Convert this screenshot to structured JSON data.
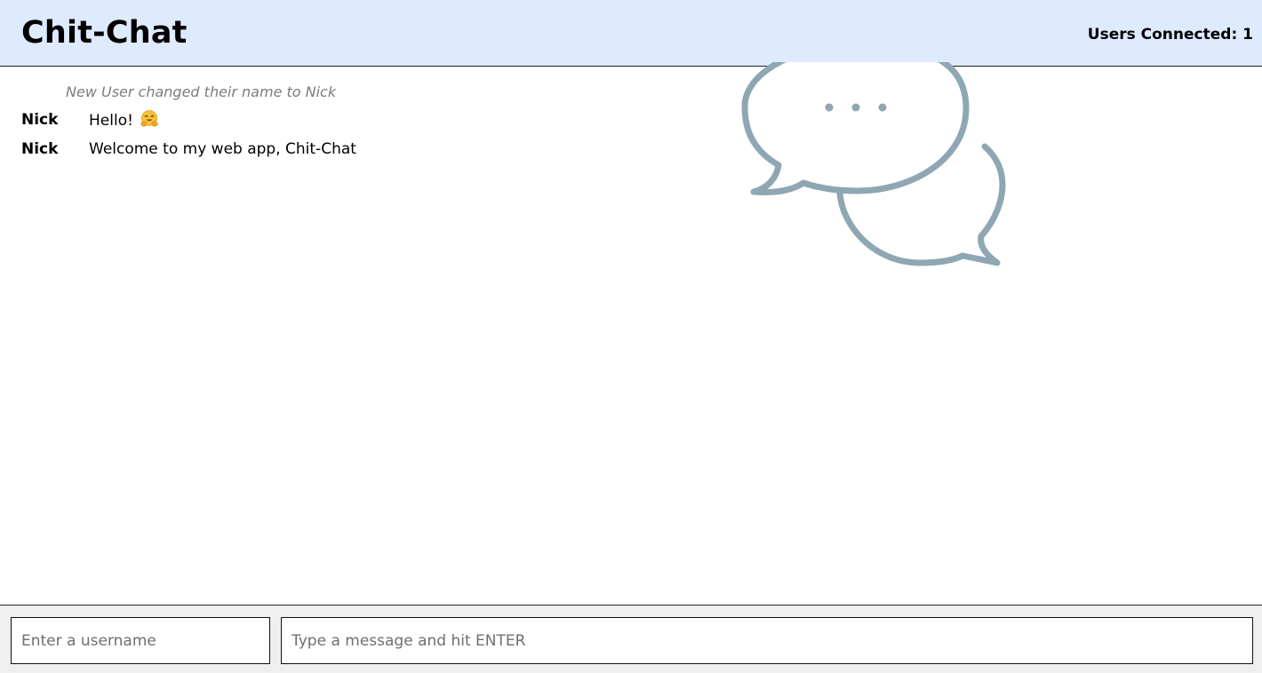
{
  "header": {
    "title": "Chit-Chat",
    "users_connected": "Users Connected: 1"
  },
  "logo": {
    "icon": "chat-bubbles-icon",
    "color": "#8ea7b3"
  },
  "messages": {
    "system": "New User changed their name to Nick",
    "items": [
      {
        "author": "Nick",
        "text": "Hello!",
        "emoji": "hugging-face-emoji"
      },
      {
        "author": "Nick",
        "text": "Welcome to my web app, Chit-Chat"
      }
    ]
  },
  "footer": {
    "username_placeholder": "Enter a username",
    "message_placeholder": "Type a message and hit ENTER"
  },
  "colors": {
    "header_bg": "#deeafd",
    "footer_bg": "#efefef",
    "system_text": "#7d7d7d"
  }
}
